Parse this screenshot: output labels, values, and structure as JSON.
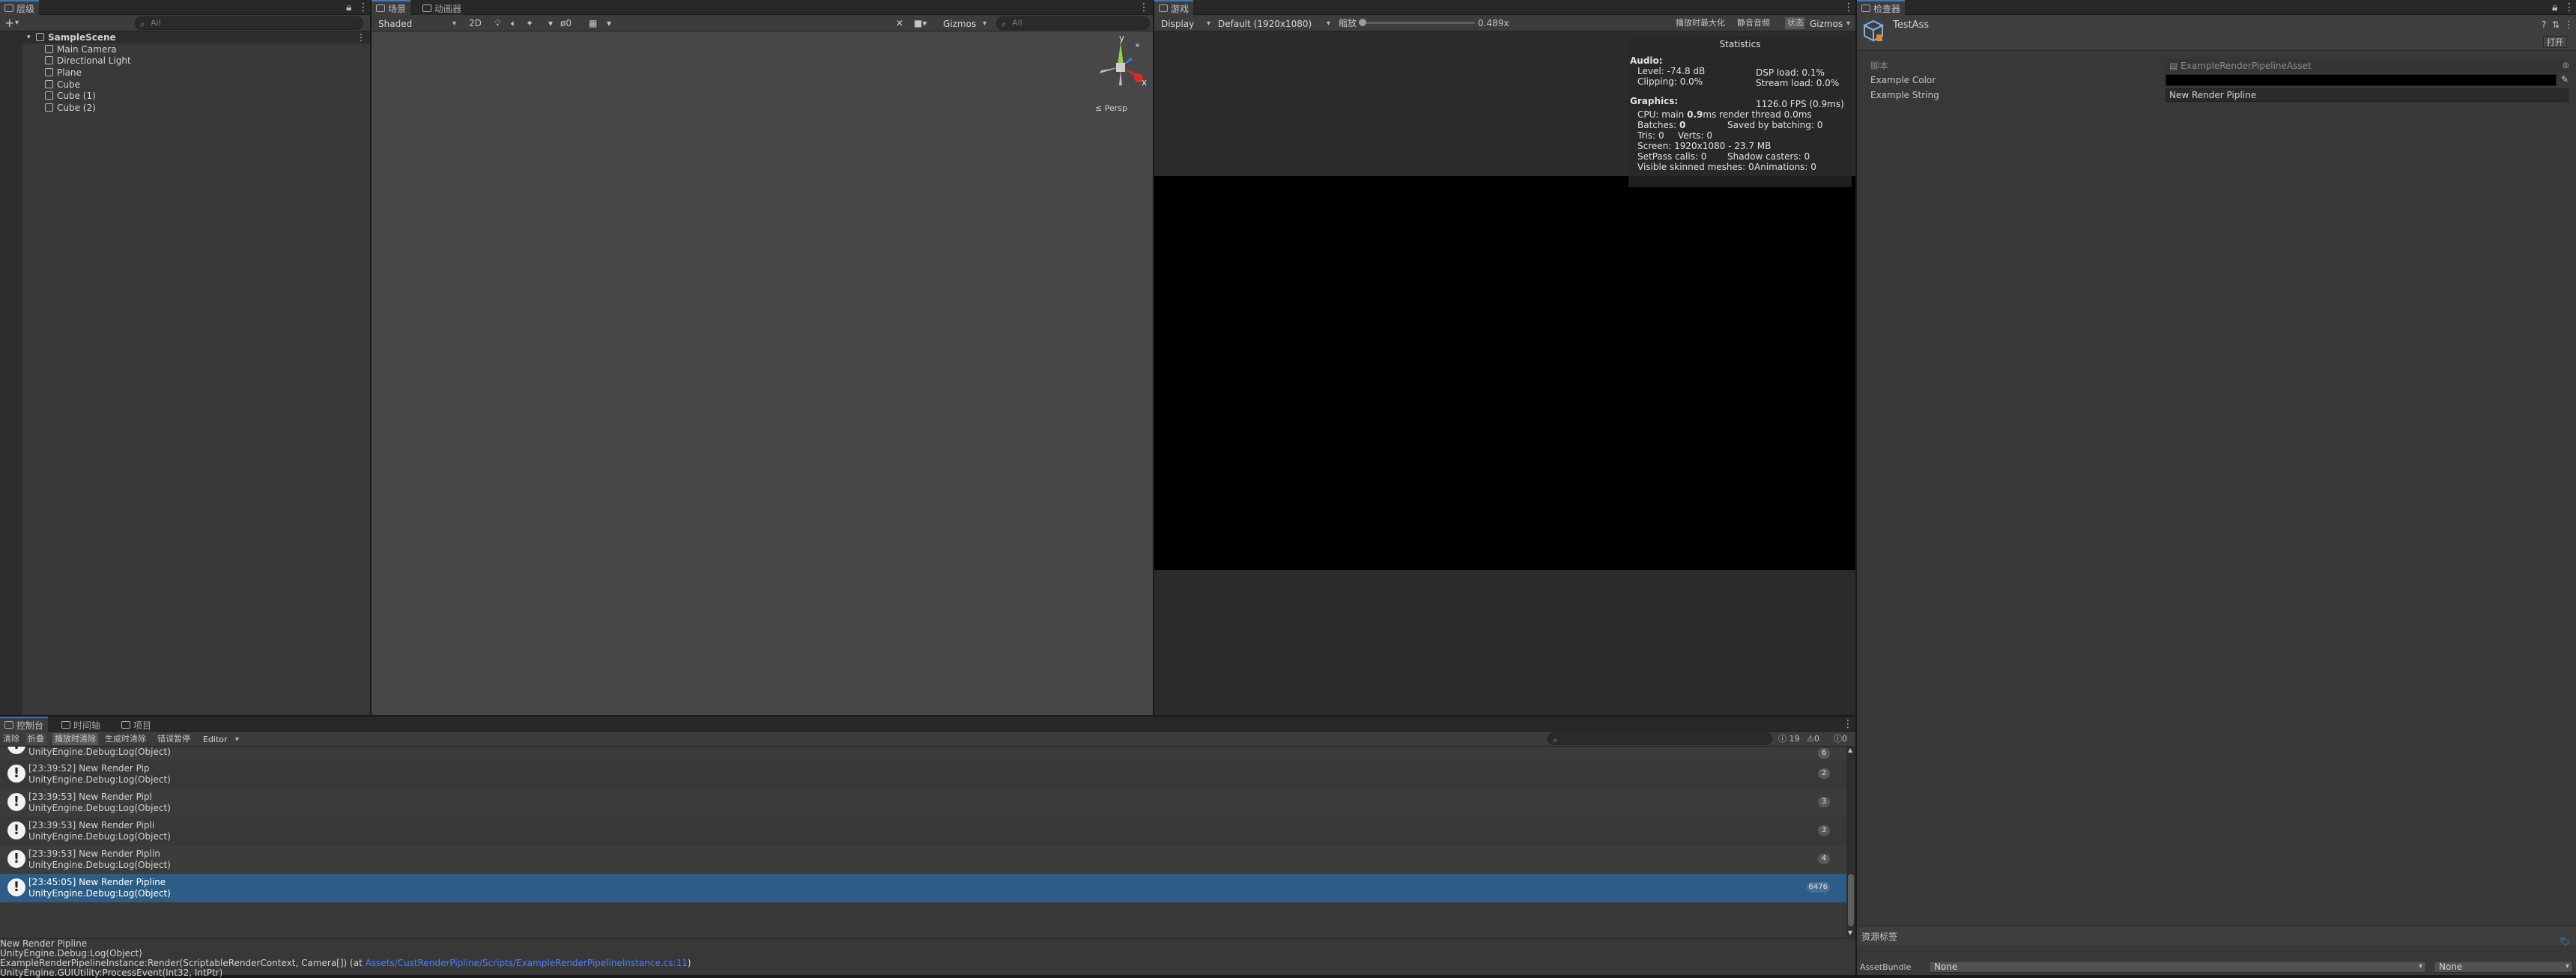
{
  "hierarchy": {
    "tab_label": "层级",
    "add_label": "+",
    "search_placeholder": "All",
    "scene_name": "SampleScene",
    "items": [
      "Main Camera",
      "Directional Light",
      "Plane",
      "Cube",
      "Cube (1)",
      "Cube (2)"
    ]
  },
  "scene": {
    "tabs": [
      "场景",
      "动画器"
    ],
    "shading_mode": "Shaded",
    "mode_2d": "2D",
    "layers_value": "0",
    "gizmos_label": "Gizmos",
    "search_placeholder": "All",
    "gizmo_axes": {
      "y": "y",
      "x": "x"
    },
    "persp_label": "≤ Persp"
  },
  "game": {
    "tab_label": "游戏",
    "display": "Display 1",
    "resolution": "Default (1920x1080)",
    "scale_label": "缩放",
    "scale_value": "0.489x",
    "scale_fraction": 0.0,
    "maximize_label": "播放时最大化",
    "mute_label": "静音音频",
    "stats_label": "状态",
    "gizmos_label": "Gizmos",
    "statistics": {
      "title": "Statistics",
      "audio_heading": "Audio:",
      "level": "Level: -74.8 dB",
      "clipping": "Clipping: 0.0%",
      "dsp_load": "DSP load: 0.1%",
      "stream_load": "Stream load: 0.0%",
      "graphics_heading": "Graphics:",
      "fps": "1126.0 FPS (0.9ms)",
      "cpu_prefix": "CPU: main ",
      "cpu_value": "0.9",
      "cpu_suffix": "ms  render thread 0.0ms",
      "batches_prefix": "Batches: ",
      "batches_value": "0",
      "saved_by_batching": "Saved by batching: 0",
      "tris": "Tris: 0",
      "verts": "Verts: 0",
      "screen": "Screen: 1920x1080 - 23.7 MB",
      "setpass": "SetPass calls: 0",
      "shadow_casters": "Shadow casters: 0",
      "skinned": "Visible skinned meshes: 0",
      "animations": "Animations: 0"
    }
  },
  "inspector": {
    "tab_label": "检查器",
    "asset_name": "TestAss",
    "open_label": "打开",
    "script_label": "脚本",
    "script_value": "ExampleRenderPipelineAsset",
    "color_label": "Example Color",
    "color_value": "#000000",
    "string_label": "Example String",
    "string_value": "New Render Pipline",
    "asset_labels_title": "资源标签",
    "asset_bundle_label": "AssetBundle",
    "asset_bundle_value": "None",
    "asset_bundle_variant": "None"
  },
  "console": {
    "tabs": [
      "控制台",
      "时间轴",
      "项目"
    ],
    "toolbar": {
      "clear": "清除",
      "collapse": "折叠",
      "clear_on_play": "播放时清除",
      "clear_on_build": "生成时清除",
      "error_pause": "错误暂停",
      "editor": "Editor"
    },
    "counts": {
      "log": "19",
      "warn": "0",
      "error": "0"
    },
    "partial_row_text": "UnityEngine.Debug:Log(Object)",
    "partial_row_count": "6",
    "rows": [
      {
        "line1": "[23:39:52] New Render Pip",
        "line2": "UnityEngine.Debug:Log(Object)",
        "count": "2"
      },
      {
        "line1": "[23:39:53] New Render Pipl",
        "line2": "UnityEngine.Debug:Log(Object)",
        "count": "3"
      },
      {
        "line1": "[23:39:53] New Render Pipli",
        "line2": "UnityEngine.Debug:Log(Object)",
        "count": "3"
      },
      {
        "line1": "[23:39:53] New Render Piplin",
        "line2": "UnityEngine.Debug:Log(Object)",
        "count": "4"
      },
      {
        "line1": "[23:45:05] New Render Pipline",
        "line2": "UnityEngine.Debug:Log(Object)",
        "count": "6476"
      }
    ],
    "detail": {
      "line1": "New Render Pipline",
      "line2": "UnityEngine.Debug:Log(Object)",
      "line3_prefix": "ExampleRenderPipelineInstance:Render(ScriptableRenderContext, Camera[]) (at ",
      "line3_link": "Assets/CustRenderPipline/Scripts/ExampleRenderPipelineInstance.cs:11",
      "line3_suffix": ")",
      "line4": "UnityEngine.GUIUtility:ProcessEvent(Int32, IntPtr)"
    }
  }
}
